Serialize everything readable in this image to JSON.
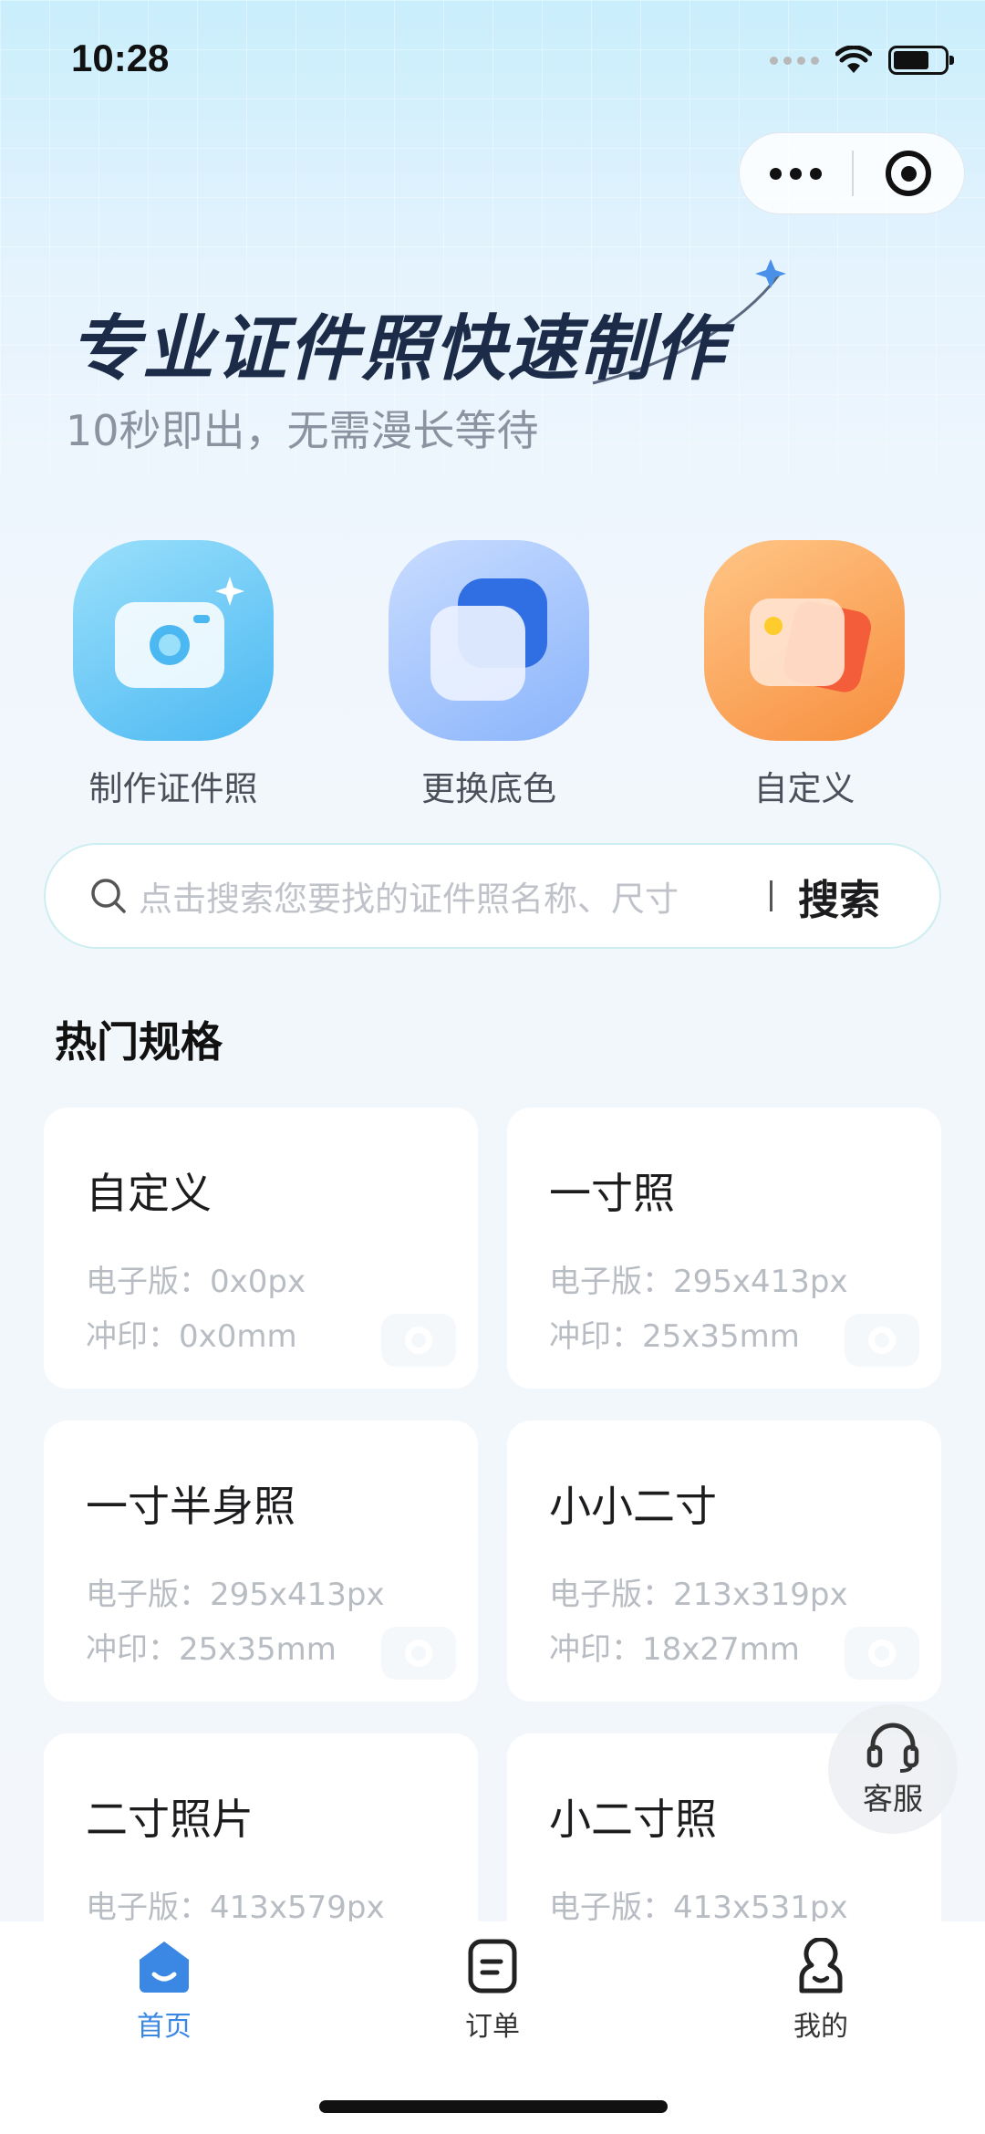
{
  "status": {
    "time": "10:28"
  },
  "hero": {
    "title": "专业证件照快速制作",
    "subtitle": "10秒即出，无需漫长等待"
  },
  "features": [
    {
      "label": "制作证件照",
      "icon": "camera-icon"
    },
    {
      "label": "更换底色",
      "icon": "layers-icon"
    },
    {
      "label": "自定义",
      "icon": "image-icon"
    }
  ],
  "search": {
    "placeholder": "点击搜索您要找的证件照名称、尺寸",
    "button": "搜索"
  },
  "section": {
    "title": "热门规格"
  },
  "specs": [
    {
      "name": "自定义",
      "digital": "电子版：0x0px",
      "print": "冲印：0x0mm"
    },
    {
      "name": "一寸照",
      "digital": "电子版：295x413px",
      "print": "冲印：25x35mm"
    },
    {
      "name": "一寸半身照",
      "digital": "电子版：295x413px",
      "print": "冲印：25x35mm"
    },
    {
      "name": "小小二寸",
      "digital": "电子版：213x319px",
      "print": "冲印：18x27mm"
    },
    {
      "name": "二寸照片",
      "digital": "电子版：413x579px",
      "print": ""
    },
    {
      "name": "小二寸照",
      "digital": "电子版：413x531px",
      "print": ""
    }
  ],
  "service": {
    "label": "客服"
  },
  "tabs": [
    {
      "label": "首页",
      "active": true
    },
    {
      "label": "订单",
      "active": false
    },
    {
      "label": "我的",
      "active": false
    }
  ],
  "colors": {
    "accent": "#3b87e4",
    "title": "#1c2b48"
  }
}
